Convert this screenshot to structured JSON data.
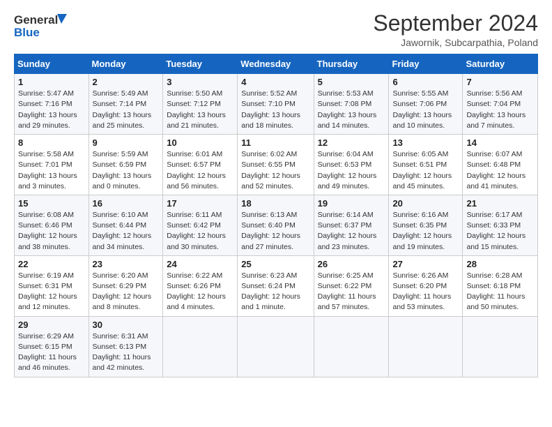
{
  "header": {
    "logo_general": "General",
    "logo_blue": "Blue",
    "month": "September 2024",
    "location": "Jawornik, Subcarpathia, Poland"
  },
  "days_of_week": [
    "Sunday",
    "Monday",
    "Tuesday",
    "Wednesday",
    "Thursday",
    "Friday",
    "Saturday"
  ],
  "weeks": [
    [
      {
        "day": "1",
        "info": "Sunrise: 5:47 AM\nSunset: 7:16 PM\nDaylight: 13 hours\nand 29 minutes."
      },
      {
        "day": "2",
        "info": "Sunrise: 5:49 AM\nSunset: 7:14 PM\nDaylight: 13 hours\nand 25 minutes."
      },
      {
        "day": "3",
        "info": "Sunrise: 5:50 AM\nSunset: 7:12 PM\nDaylight: 13 hours\nand 21 minutes."
      },
      {
        "day": "4",
        "info": "Sunrise: 5:52 AM\nSunset: 7:10 PM\nDaylight: 13 hours\nand 18 minutes."
      },
      {
        "day": "5",
        "info": "Sunrise: 5:53 AM\nSunset: 7:08 PM\nDaylight: 13 hours\nand 14 minutes."
      },
      {
        "day": "6",
        "info": "Sunrise: 5:55 AM\nSunset: 7:06 PM\nDaylight: 13 hours\nand 10 minutes."
      },
      {
        "day": "7",
        "info": "Sunrise: 5:56 AM\nSunset: 7:04 PM\nDaylight: 13 hours\nand 7 minutes."
      }
    ],
    [
      {
        "day": "8",
        "info": "Sunrise: 5:58 AM\nSunset: 7:01 PM\nDaylight: 13 hours\nand 3 minutes."
      },
      {
        "day": "9",
        "info": "Sunrise: 5:59 AM\nSunset: 6:59 PM\nDaylight: 13 hours\nand 0 minutes."
      },
      {
        "day": "10",
        "info": "Sunrise: 6:01 AM\nSunset: 6:57 PM\nDaylight: 12 hours\nand 56 minutes."
      },
      {
        "day": "11",
        "info": "Sunrise: 6:02 AM\nSunset: 6:55 PM\nDaylight: 12 hours\nand 52 minutes."
      },
      {
        "day": "12",
        "info": "Sunrise: 6:04 AM\nSunset: 6:53 PM\nDaylight: 12 hours\nand 49 minutes."
      },
      {
        "day": "13",
        "info": "Sunrise: 6:05 AM\nSunset: 6:51 PM\nDaylight: 12 hours\nand 45 minutes."
      },
      {
        "day": "14",
        "info": "Sunrise: 6:07 AM\nSunset: 6:48 PM\nDaylight: 12 hours\nand 41 minutes."
      }
    ],
    [
      {
        "day": "15",
        "info": "Sunrise: 6:08 AM\nSunset: 6:46 PM\nDaylight: 12 hours\nand 38 minutes."
      },
      {
        "day": "16",
        "info": "Sunrise: 6:10 AM\nSunset: 6:44 PM\nDaylight: 12 hours\nand 34 minutes."
      },
      {
        "day": "17",
        "info": "Sunrise: 6:11 AM\nSunset: 6:42 PM\nDaylight: 12 hours\nand 30 minutes."
      },
      {
        "day": "18",
        "info": "Sunrise: 6:13 AM\nSunset: 6:40 PM\nDaylight: 12 hours\nand 27 minutes."
      },
      {
        "day": "19",
        "info": "Sunrise: 6:14 AM\nSunset: 6:37 PM\nDaylight: 12 hours\nand 23 minutes."
      },
      {
        "day": "20",
        "info": "Sunrise: 6:16 AM\nSunset: 6:35 PM\nDaylight: 12 hours\nand 19 minutes."
      },
      {
        "day": "21",
        "info": "Sunrise: 6:17 AM\nSunset: 6:33 PM\nDaylight: 12 hours\nand 15 minutes."
      }
    ],
    [
      {
        "day": "22",
        "info": "Sunrise: 6:19 AM\nSunset: 6:31 PM\nDaylight: 12 hours\nand 12 minutes."
      },
      {
        "day": "23",
        "info": "Sunrise: 6:20 AM\nSunset: 6:29 PM\nDaylight: 12 hours\nand 8 minutes."
      },
      {
        "day": "24",
        "info": "Sunrise: 6:22 AM\nSunset: 6:26 PM\nDaylight: 12 hours\nand 4 minutes."
      },
      {
        "day": "25",
        "info": "Sunrise: 6:23 AM\nSunset: 6:24 PM\nDaylight: 12 hours\nand 1 minute."
      },
      {
        "day": "26",
        "info": "Sunrise: 6:25 AM\nSunset: 6:22 PM\nDaylight: 11 hours\nand 57 minutes."
      },
      {
        "day": "27",
        "info": "Sunrise: 6:26 AM\nSunset: 6:20 PM\nDaylight: 11 hours\nand 53 minutes."
      },
      {
        "day": "28",
        "info": "Sunrise: 6:28 AM\nSunset: 6:18 PM\nDaylight: 11 hours\nand 50 minutes."
      }
    ],
    [
      {
        "day": "29",
        "info": "Sunrise: 6:29 AM\nSunset: 6:15 PM\nDaylight: 11 hours\nand 46 minutes."
      },
      {
        "day": "30",
        "info": "Sunrise: 6:31 AM\nSunset: 6:13 PM\nDaylight: 11 hours\nand 42 minutes."
      },
      {
        "day": "",
        "info": ""
      },
      {
        "day": "",
        "info": ""
      },
      {
        "day": "",
        "info": ""
      },
      {
        "day": "",
        "info": ""
      },
      {
        "day": "",
        "info": ""
      }
    ]
  ]
}
